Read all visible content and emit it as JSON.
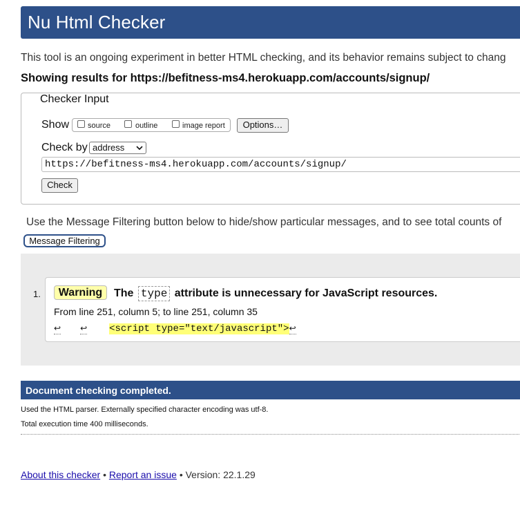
{
  "header": {
    "title": "Nu Html Checker"
  },
  "intro": "This tool is an ongoing experiment in better HTML checking, and its behavior remains subject to chang",
  "showing_results": "Showing results for https://befitness-ms4.herokuapp.com/accounts/signup/",
  "checker_input": {
    "legend": "Checker Input",
    "show_label": "Show",
    "options": [
      {
        "label": "source",
        "checked": false
      },
      {
        "label": "outline",
        "checked": false
      },
      {
        "label": "image report",
        "checked": false
      }
    ],
    "options_button": "Options…",
    "check_by_label": "Check by",
    "check_by_value": "address",
    "url_value": "https://befitness-ms4.herokuapp.com/accounts/signup/",
    "check_button": "Check"
  },
  "filtering": {
    "text": "Use the Message Filtering button below to hide/show particular messages, and to see total counts of",
    "button": "Message Filtering"
  },
  "messages": [
    {
      "number": "1.",
      "type": "Warning",
      "text_before": "The",
      "code": "type",
      "text_after": "attribute is unnecessary for JavaScript resources.",
      "location": "From line 251, column 5; to line 251, column 35",
      "newline_glyph": "↩",
      "extract_code": "<script type=\"text/javascript\">"
    }
  ],
  "completion": {
    "title": "Document checking completed.",
    "parser_info": "Used the HTML parser. Externally specified character encoding was utf-8.",
    "execution_time": "Total execution time 400 milliseconds."
  },
  "footer": {
    "about_link": "About this checker",
    "separator": "•",
    "report_link": "Report an issue",
    "version": "Version: 22.1.29"
  }
}
